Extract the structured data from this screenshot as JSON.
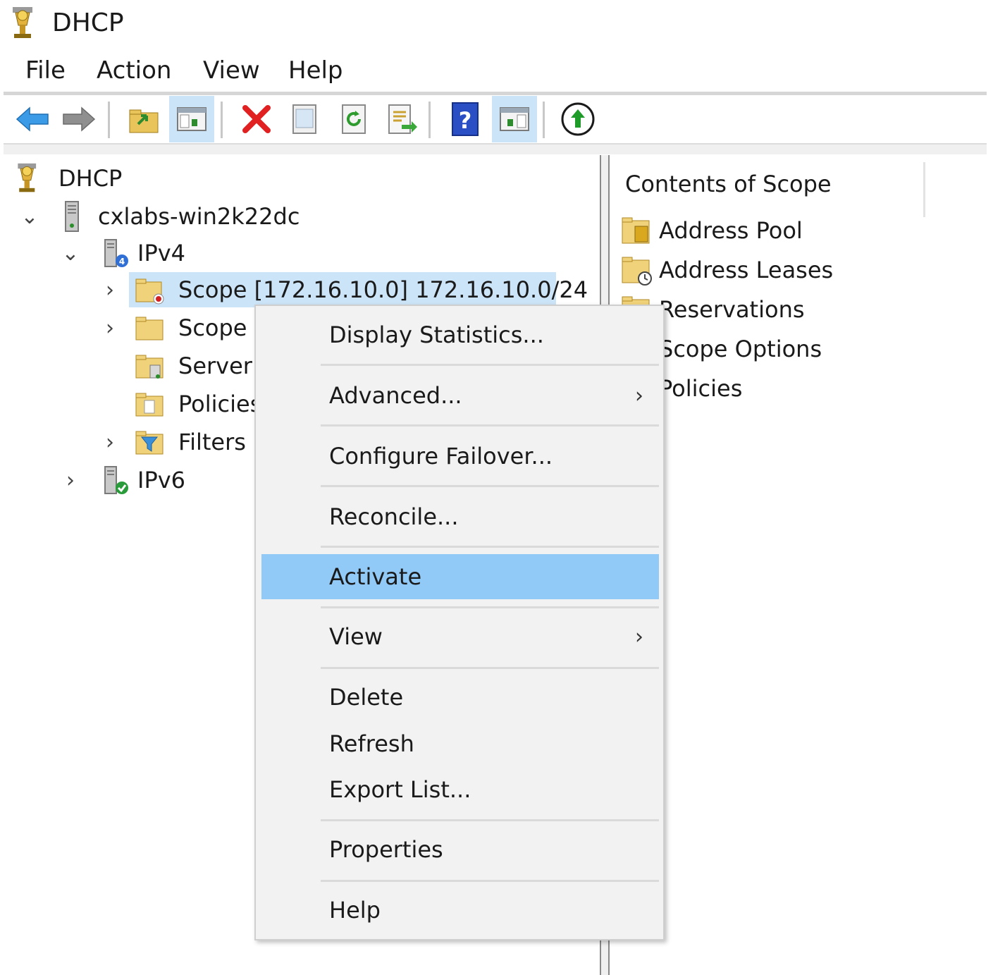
{
  "window": {
    "title": "DHCP"
  },
  "menubar": {
    "items": [
      {
        "label": "File"
      },
      {
        "label": "Action"
      },
      {
        "label": "View"
      },
      {
        "label": "Help"
      }
    ]
  },
  "toolbar": {
    "buttons": [
      {
        "icon": "back-arrow-icon"
      },
      {
        "icon": "forward-arrow-icon"
      },
      {
        "icon": "up-folder-icon"
      },
      {
        "icon": "show-hide-console-tree-icon"
      },
      {
        "icon": "delete-icon"
      },
      {
        "icon": "properties-icon"
      },
      {
        "icon": "refresh-icon"
      },
      {
        "icon": "export-list-icon"
      },
      {
        "icon": "help-icon"
      },
      {
        "icon": "show-hide-action-pane-icon"
      },
      {
        "icon": "activate-icon"
      }
    ]
  },
  "tree": {
    "root": "DHCP",
    "server": "cxlabs-win2k22dc",
    "ipv4": "IPv4",
    "scope1": "Scope [172.16.10.0] 172.16.10.0/24",
    "scope2": "Scope [",
    "server_options": "Server (",
    "policies": "Policies",
    "filters": "Filters",
    "ipv6": "IPv6"
  },
  "content": {
    "header": "Contents of Scope",
    "items": [
      {
        "label": "Address Pool"
      },
      {
        "label": "Address Leases"
      },
      {
        "label": "Reservations"
      },
      {
        "label": "Scope Options"
      },
      {
        "label": "Policies"
      }
    ]
  },
  "context_menu": {
    "items": [
      {
        "label": "Display Statistics..."
      },
      {
        "label": "Advanced...",
        "submenu": "›"
      },
      {
        "label": "Configure Failover..."
      },
      {
        "label": "Reconcile..."
      },
      {
        "label": "Activate"
      },
      {
        "label": "View",
        "submenu": "›"
      },
      {
        "label": "Delete"
      },
      {
        "label": "Refresh"
      },
      {
        "label": "Export List..."
      },
      {
        "label": "Properties"
      },
      {
        "label": "Help"
      }
    ],
    "highlighted": "Activate"
  },
  "colors": {
    "selection": "#cce4f7",
    "menu_highlight": "#91c9f7",
    "menu_background": "#f2f2f2"
  }
}
